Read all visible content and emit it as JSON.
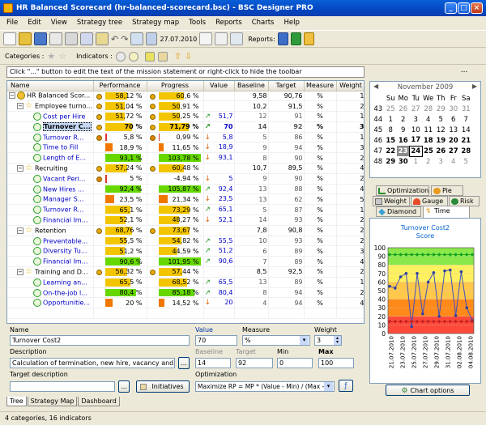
{
  "window": {
    "title": "HR Balanced Scorecard (hr-balanced-scorecard.bsc) - BSC Designer PRO"
  },
  "menu": [
    "File",
    "Edit",
    "View",
    "Strategy tree",
    "Strategy map",
    "Tools",
    "Reports",
    "Charts",
    "Help"
  ],
  "toolbar": {
    "date": "27.07.2010",
    "reports_label": "Reports:"
  },
  "toolbar2": {
    "categories_label": "Categories :",
    "indicators_label": "Indicators :"
  },
  "hint": {
    "text": "Click \"...\" button to edit the text of the mission statement or right-click to hide the toolbar",
    "button": "..."
  },
  "columns": [
    "Name",
    "Performance",
    "Progress",
    "Value",
    "Baseline",
    "Target",
    "Measure",
    "Weight"
  ],
  "rows": [
    {
      "level": 0,
      "tw": "−",
      "icon": "scorecard",
      "name": "HR Balanced Scor...",
      "perf": 58.12,
      "perf_t": "58,12 %",
      "perf_c": "#f2c500",
      "dot": "#e8a800",
      "prog": 60.6,
      "prog_t": "60,6 %",
      "prog_c": "#f2c500",
      "pdot": "#e8a800",
      "arrow": "",
      "aclr": "",
      "value": "",
      "baseline": "9,58",
      "target": "90,76",
      "measure": "%",
      "weight": "1",
      "bold": false
    },
    {
      "level": 1,
      "tw": "−",
      "icon": "star",
      "name": "Employee turno...",
      "perf": 51.04,
      "perf_t": "51,04 %",
      "perf_c": "#f2c500",
      "dot": "#e8a800",
      "prog": 50.91,
      "prog_t": "50,91 %",
      "prog_c": "#f2c500",
      "pdot": "#e8a800",
      "arrow": "",
      "aclr": "",
      "value": "",
      "baseline": "10,2",
      "target": "91,5",
      "measure": "%",
      "weight": "2",
      "bold": false
    },
    {
      "level": 2,
      "tw": "",
      "icon": "gauge",
      "name": "Cost per Hire",
      "perf": 51.72,
      "perf_t": "51,72 %",
      "perf_c": "#f2c500",
      "dot": "#e8a800",
      "prog": 50.25,
      "prog_t": "50,25 %",
      "prog_c": "#f2c500",
      "pdot": "#e8a800",
      "arrow": "↗",
      "aclr": "#2a9a2a",
      "value": "51,7",
      "baseline": "12",
      "target": "91",
      "measure": "%",
      "weight": "1",
      "bold": false,
      "link": true
    },
    {
      "level": 2,
      "tw": "",
      "icon": "gauge",
      "name": "Turnover C...",
      "perf": 70,
      "perf_t": "70 %",
      "perf_c": "#f2c500",
      "dot": "#e8a800",
      "prog": 71.79,
      "prog_t": "71,79 %",
      "prog_c": "#f2c500",
      "pdot": "#e8a800",
      "arrow": "↗",
      "aclr": "#2a9a2a",
      "value": "70",
      "baseline": "14",
      "target": "92",
      "measure": "%",
      "weight": "3",
      "bold": true,
      "selected": true
    },
    {
      "level": 2,
      "tw": "",
      "icon": "gauge",
      "name": "Turnover R...",
      "perf": 5.8,
      "perf_t": "5,8 %",
      "perf_c": "#e03030",
      "dot": "#e08000",
      "prog": 0.99,
      "prog_t": "0,99 %",
      "prog_c": "#e03030",
      "pdot": "#e08000",
      "arrow": "↓",
      "aclr": "#e05a00",
      "value": "5,8",
      "baseline": "5",
      "target": "86",
      "measure": "%",
      "weight": "1",
      "bold": false,
      "link": true
    },
    {
      "level": 2,
      "tw": "",
      "icon": "gauge",
      "name": "Time to Fill",
      "perf": 18.9,
      "perf_t": "18,9 %",
      "perf_c": "#f07800",
      "dot": "",
      "prog": 11.65,
      "prog_t": "11,65 %",
      "prog_c": "#f07800",
      "pdot": "",
      "arrow": "↓",
      "aclr": "#e05a00",
      "value": "18,9",
      "baseline": "9",
      "target": "94",
      "measure": "%",
      "weight": "3",
      "bold": false,
      "link": true
    },
    {
      "level": 2,
      "tw": "",
      "icon": "gauge",
      "name": "Length of E...",
      "perf": 93.1,
      "perf_t": "93,1 %",
      "perf_c": "#66d800",
      "dot": "",
      "prog": 103.78,
      "prog_t": "103,78 %",
      "prog_c": "#66d800",
      "pdot": "",
      "arrow": "↓",
      "aclr": "#e05a00",
      "value": "93,1",
      "baseline": "8",
      "target": "90",
      "measure": "%",
      "weight": "2",
      "bold": false,
      "link": true
    },
    {
      "level": 1,
      "tw": "−",
      "icon": "star",
      "name": "Recruiting",
      "perf": 57.24,
      "perf_t": "57,24 %",
      "perf_c": "#f2c500",
      "dot": "#e8a800",
      "prog": 60.48,
      "prog_t": "60,48 %",
      "prog_c": "#f2c500",
      "pdot": "#e8a800",
      "arrow": "",
      "aclr": "",
      "value": "",
      "baseline": "10,7",
      "target": "89,5",
      "measure": "%",
      "weight": "4",
      "bold": false
    },
    {
      "level": 2,
      "tw": "",
      "icon": "gauge",
      "name": "Vacant Peri...",
      "perf": 5,
      "perf_t": "5 %",
      "perf_c": "#e03030",
      "dot": "#e08000",
      "prog": -4.94,
      "prog_t": "-4,94 %",
      "prog_c": "#e03030",
      "pdot": "",
      "arrow": "↓",
      "aclr": "#e05a00",
      "value": "5",
      "baseline": "9",
      "target": "90",
      "measure": "%",
      "weight": "2",
      "bold": false,
      "link": true
    },
    {
      "level": 2,
      "tw": "",
      "icon": "gauge",
      "name": "New Hires ...",
      "perf": 92.4,
      "perf_t": "92,4 %",
      "perf_c": "#66d800",
      "dot": "",
      "prog": 105.87,
      "prog_t": "105,87 %",
      "prog_c": "#66d800",
      "pdot": "",
      "arrow": "↗",
      "aclr": "#2a9a2a",
      "value": "92,4",
      "baseline": "13",
      "target": "88",
      "measure": "%",
      "weight": "4",
      "bold": false,
      "link": true
    },
    {
      "level": 2,
      "tw": "",
      "icon": "gauge",
      "name": "Manager S...",
      "perf": 23.5,
      "perf_t": "23,5 %",
      "perf_c": "#f07800",
      "dot": "",
      "prog": 21.34,
      "prog_t": "21,34 %",
      "prog_c": "#f07800",
      "pdot": "",
      "arrow": "↓",
      "aclr": "#e05a00",
      "value": "23,5",
      "baseline": "13",
      "target": "62",
      "measure": "%",
      "weight": "5",
      "bold": false,
      "link": true
    },
    {
      "level": 2,
      "tw": "",
      "icon": "gauge",
      "name": "Turnover R...",
      "perf": 65.1,
      "perf_t": "65,1 %",
      "perf_c": "#f2c500",
      "dot": "",
      "prog": 73.29,
      "prog_t": "73,29 %",
      "prog_c": "#f2c500",
      "pdot": "",
      "arrow": "↗",
      "aclr": "#2a9a2a",
      "value": "65,1",
      "baseline": "5",
      "target": "87",
      "measure": "%",
      "weight": "1",
      "bold": false,
      "link": true
    },
    {
      "level": 2,
      "tw": "",
      "icon": "gauge",
      "name": "Financial Im...",
      "perf": 52.1,
      "perf_t": "52,1 %",
      "perf_c": "#f2c500",
      "dot": "",
      "prog": 48.27,
      "prog_t": "48,27 %",
      "prog_c": "#f2c500",
      "pdot": "",
      "arrow": "↓",
      "aclr": "#e05a00",
      "value": "52,1",
      "baseline": "14",
      "target": "93",
      "measure": "%",
      "weight": "2",
      "bold": false,
      "link": true
    },
    {
      "level": 1,
      "tw": "−",
      "icon": "star",
      "name": "Retention",
      "perf": 68.76,
      "perf_t": "68,76 %",
      "perf_c": "#f2c500",
      "dot": "#e8a800",
      "prog": 73.67,
      "prog_t": "73,67 %",
      "prog_c": "#f2c500",
      "pdot": "#e8a800",
      "arrow": "",
      "aclr": "",
      "value": "",
      "baseline": "7,8",
      "target": "90,8",
      "measure": "%",
      "weight": "2",
      "bold": false
    },
    {
      "level": 2,
      "tw": "",
      "icon": "gauge",
      "name": "Preventable...",
      "perf": 55.5,
      "perf_t": "55,5 %",
      "perf_c": "#f2c500",
      "dot": "",
      "prog": 54.82,
      "prog_t": "54,82 %",
      "prog_c": "#f2c500",
      "pdot": "",
      "arrow": "↗",
      "aclr": "#2a9a2a",
      "value": "55,5",
      "baseline": "10",
      "target": "93",
      "measure": "%",
      "weight": "2",
      "bold": false,
      "link": true
    },
    {
      "level": 2,
      "tw": "",
      "icon": "gauge",
      "name": "Diversity Tu...",
      "perf": 51.2,
      "perf_t": "51,2 %",
      "perf_c": "#f2c500",
      "dot": "",
      "prog": 44.59,
      "prog_t": "44,59 %",
      "prog_c": "#f2c500",
      "pdot": "",
      "arrow": "↗",
      "aclr": "#2a9a2a",
      "value": "51,2",
      "baseline": "6",
      "target": "89",
      "measure": "%",
      "weight": "3",
      "bold": false,
      "link": true
    },
    {
      "level": 2,
      "tw": "",
      "icon": "gauge",
      "name": "Financial Im...",
      "perf": 90.6,
      "perf_t": "90,6 %",
      "perf_c": "#66d800",
      "dot": "",
      "prog": 101.95,
      "prog_t": "101,95 %",
      "prog_c": "#66d800",
      "pdot": "",
      "arrow": "↗",
      "aclr": "#2a9a2a",
      "value": "90,6",
      "baseline": "7",
      "target": "89",
      "measure": "%",
      "weight": "4",
      "bold": false,
      "link": true
    },
    {
      "level": 1,
      "tw": "−",
      "icon": "star",
      "name": "Training and D...",
      "perf": 56.32,
      "perf_t": "56,32 %",
      "perf_c": "#f2c500",
      "dot": "#e8a800",
      "prog": 57.44,
      "prog_t": "57,44 %",
      "prog_c": "#f2c500",
      "pdot": "#e8a800",
      "arrow": "",
      "aclr": "",
      "value": "",
      "baseline": "8,5",
      "target": "92,5",
      "measure": "%",
      "weight": "2",
      "bold": false
    },
    {
      "level": 2,
      "tw": "",
      "icon": "gauge",
      "name": "Learning an...",
      "perf": 65.5,
      "perf_t": "65,5 %",
      "perf_c": "#f2c500",
      "dot": "",
      "prog": 68.52,
      "prog_t": "68,52 %",
      "prog_c": "#f2c500",
      "pdot": "",
      "arrow": "↗",
      "aclr": "#2a9a2a",
      "value": "65,5",
      "baseline": "13",
      "target": "89",
      "measure": "%",
      "weight": "1",
      "bold": false,
      "link": true
    },
    {
      "level": 2,
      "tw": "",
      "icon": "gauge",
      "name": "On-the-job l...",
      "perf": 80.4,
      "perf_t": "80,4 %",
      "perf_c": "#66d800",
      "dot": "",
      "prog": 85.18,
      "prog_t": "85,18 %",
      "prog_c": "#66d800",
      "pdot": "",
      "arrow": "↗",
      "aclr": "#2a9a2a",
      "value": "80,4",
      "baseline": "8",
      "target": "94",
      "measure": "%",
      "weight": "2",
      "bold": false,
      "link": true
    },
    {
      "level": 2,
      "tw": "",
      "icon": "gauge",
      "name": "Opportunitie...",
      "perf": 20,
      "perf_t": "20 %",
      "perf_c": "#f07800",
      "dot": "",
      "prog": 14.52,
      "prog_t": "14,52 %",
      "prog_c": "#f07800",
      "pdot": "",
      "arrow": "↓",
      "aclr": "#e05a00",
      "value": "20",
      "baseline": "4",
      "target": "94",
      "measure": "%",
      "weight": "4",
      "bold": false,
      "link": true
    }
  ],
  "props": {
    "name_label": "Name",
    "name_value": "Turnover Cost2",
    "value_label": "Value",
    "value_value": "70",
    "measure_label": "Measure",
    "measure_value": "%",
    "weight_label": "Weight",
    "weight_value": "3",
    "desc_label": "Description",
    "desc_value": "Calculation of termination, new hire, vacancy and",
    "desc_btn": "...",
    "baseline_label": "Baseline",
    "baseline_value": "14",
    "target_label": "Target",
    "target_value": "92",
    "min_label": "Min",
    "min_value": "0",
    "max_label": "Max",
    "max_value": "100",
    "target_desc_label": "Target description",
    "target_desc_value": "",
    "target_desc_btn": "...",
    "initiatives_btn": "Initiatives",
    "optimization_label": "Optimization",
    "optimization_value": "Maximize RP = MP * (Value - Min) / (Max - Min)"
  },
  "bottom_tabs": [
    "Tree",
    "Strategy Map",
    "Dashboard"
  ],
  "status": "4 categories, 16 indicators",
  "calendar": {
    "title": "November 2009",
    "days": [
      "Su",
      "Mo",
      "Tu",
      "We",
      "Th",
      "Fr",
      "Sa"
    ],
    "weeks": [
      {
        "wk": "43",
        "d": [
          "25",
          "26",
          "27",
          "28",
          "29",
          "30",
          "31"
        ]
      },
      {
        "wk": "44",
        "d": [
          "1",
          "2",
          "3",
          "4",
          "5",
          "6",
          "7"
        ]
      },
      {
        "wk": "45",
        "d": [
          "8",
          "9",
          "10",
          "11",
          "12",
          "13",
          "14"
        ]
      },
      {
        "wk": "46",
        "d": [
          "15",
          "16",
          "17",
          "18",
          "19",
          "20",
          "21"
        ]
      },
      {
        "wk": "47",
        "d": [
          "22",
          "23",
          "24",
          "25",
          "26",
          "27",
          "28"
        ]
      },
      {
        "wk": "48",
        "d": [
          "29",
          "30",
          "1",
          "2",
          "3",
          "4",
          "5"
        ]
      }
    ]
  },
  "chart_tabs": [
    "Optimization",
    "Pie",
    "Weight",
    "Gauge",
    "Risk",
    "Diamond",
    "Time"
  ],
  "chart_data": {
    "type": "line",
    "title": "Turnover Cost2",
    "subtitle": "Score",
    "x": [
      "21.07.2010",
      "23.07.2010",
      "25.07.2010",
      "27.07.2010",
      "29.07.2010",
      "31.07.2010",
      "02.08.2010",
      "04.08.2010"
    ],
    "ylim": [
      0,
      100
    ],
    "yticks": [
      0,
      10,
      20,
      30,
      40,
      50,
      60,
      70,
      80,
      90,
      100
    ],
    "series": [
      {
        "values": [
          55,
          53,
          66,
          70,
          8,
          70,
          23,
          60,
          71,
          20,
          73,
          74,
          21,
          72,
          30,
          15
        ]
      },
      {
        "values": [
          92,
          92,
          92,
          92,
          92,
          92,
          92,
          92,
          92,
          92,
          92,
          92,
          92,
          92,
          92,
          92
        ]
      },
      {
        "values": [
          14,
          14,
          14,
          14,
          14,
          14,
          14,
          14,
          14,
          14,
          14,
          14,
          14,
          14,
          14,
          14
        ]
      }
    ],
    "bands": [
      "#ff4a3a",
      "#ff8a1a",
      "#ffc84a",
      "#fff060",
      "#8ae84a"
    ],
    "grid": true
  },
  "chart_options_btn": "Chart options"
}
